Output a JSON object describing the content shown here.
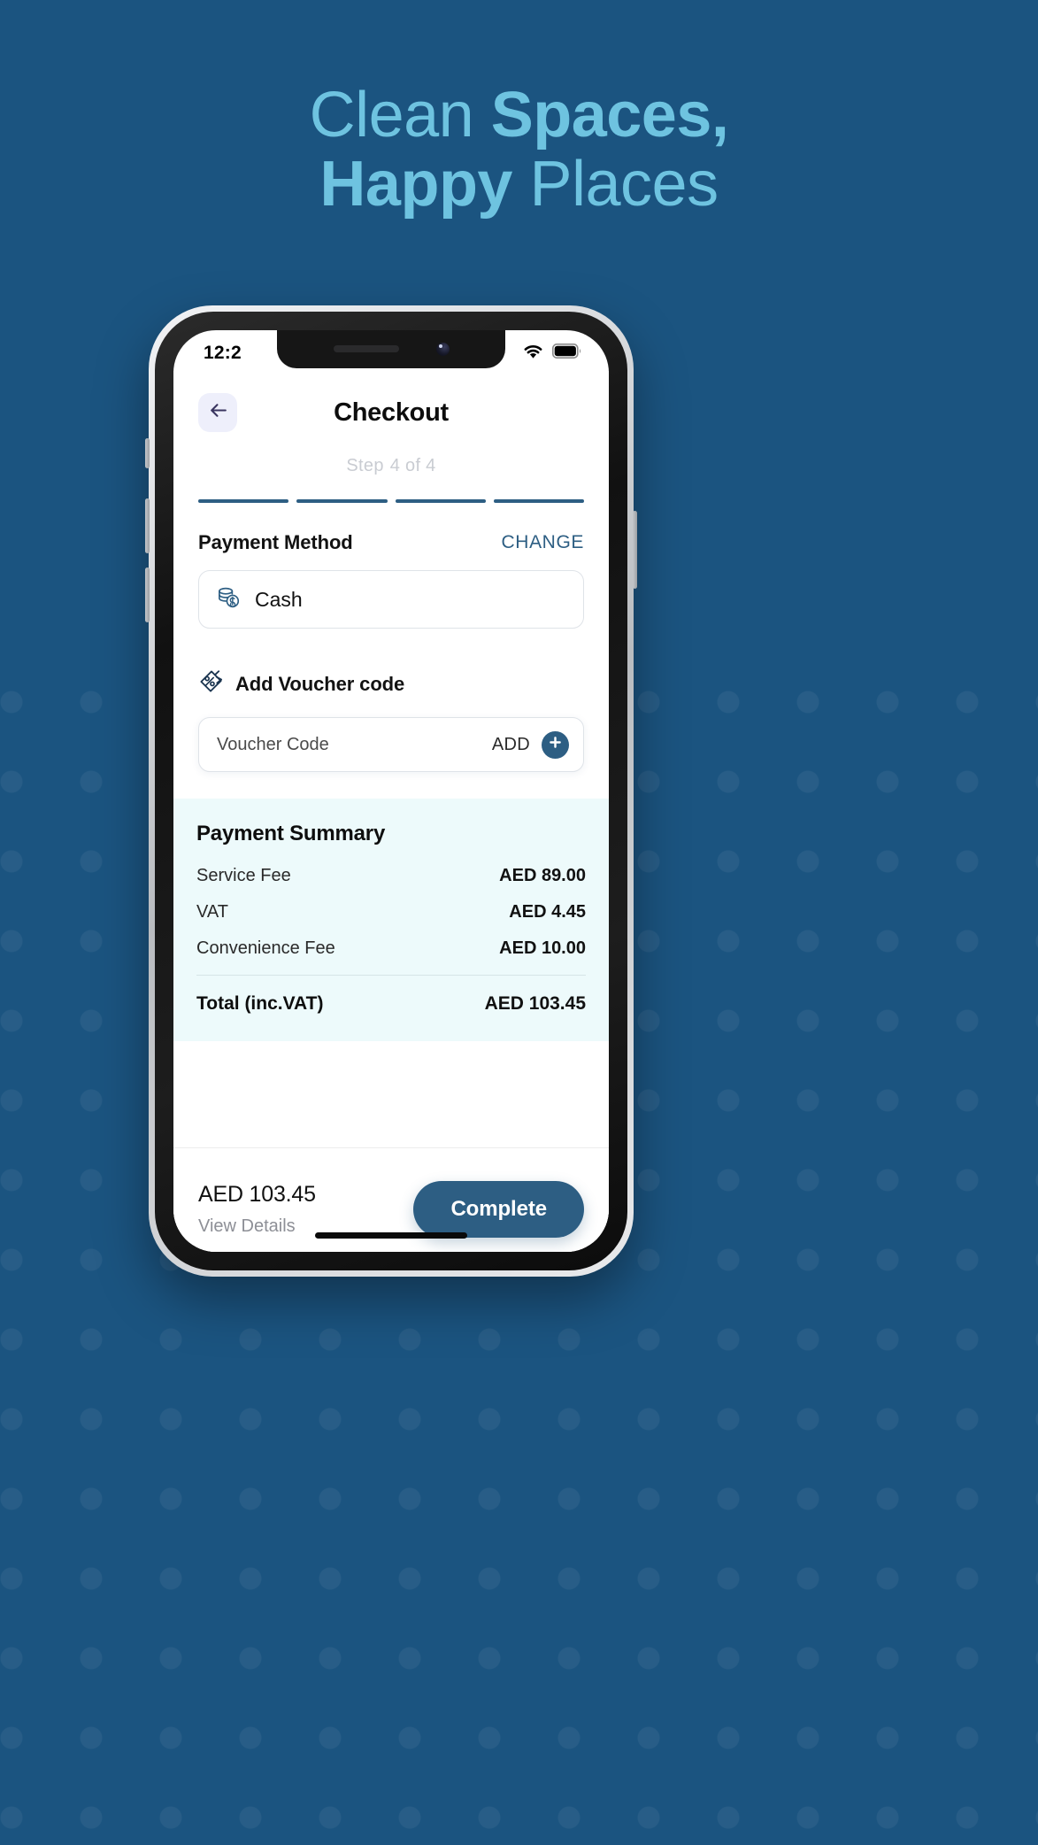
{
  "hero": {
    "line1_light": "Clean ",
    "line1_bold": "Spaces,",
    "line2_bold": "Happy ",
    "line2_light": "Places",
    "text_color": "#6ec3e0",
    "background_color": "#1b5480"
  },
  "status_bar": {
    "time": "12:2",
    "wifi_icon": "wifi-icon",
    "battery_icon": "battery-full-icon"
  },
  "header": {
    "back_icon": "arrow-left-icon",
    "title": "Checkout",
    "step_text": "Step",
    "step_value": "4 of 4",
    "total_steps": 4,
    "completed_steps": 4,
    "accent_color": "#2d5e83"
  },
  "payment_method": {
    "section_title": "Payment Method",
    "change_label": "CHANGE",
    "selected": {
      "icon": "coins-icon",
      "label": "Cash"
    }
  },
  "voucher": {
    "icon": "discount-tag-icon",
    "heading": "Add Voucher code",
    "input_value": "",
    "input_placeholder": "Voucher Code",
    "add_label": "ADD",
    "add_icon": "plus-circle-icon"
  },
  "summary": {
    "title": "Payment Summary",
    "rows": [
      {
        "label": "Service Fee",
        "value": "AED  89.00"
      },
      {
        "label": "VAT",
        "value": "AED 4.45"
      },
      {
        "label": "Convenience Fee",
        "value": "AED 10.00"
      }
    ],
    "total": {
      "label": "Total (inc.VAT)",
      "value": "AED 103.45"
    },
    "background_color": "#edfafb"
  },
  "bottom_bar": {
    "total": "AED 103.45",
    "view_details": "View Details",
    "action_label": "Complete"
  }
}
